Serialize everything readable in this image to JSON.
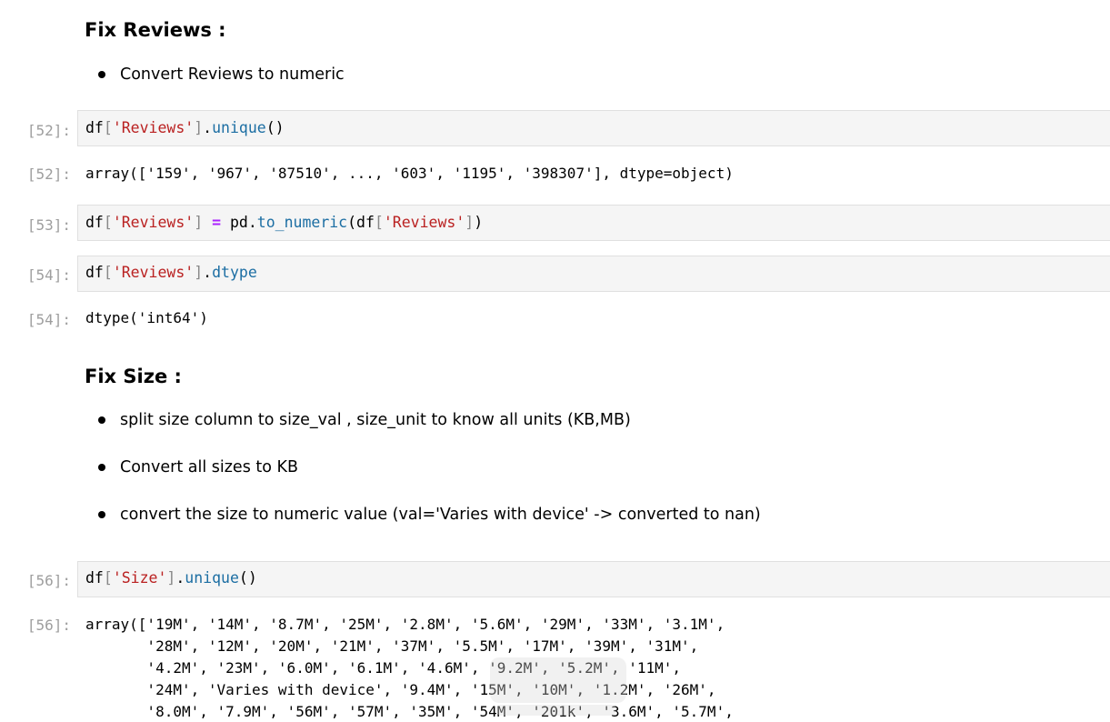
{
  "sections": {
    "fix_reviews": {
      "heading": "Fix Reviews :",
      "bullets": [
        "Convert Reviews to numeric"
      ]
    },
    "fix_size": {
      "heading": "Fix Size :",
      "bullets": [
        "split size column to size_val , size_unit to know all units (KB,MB)",
        "Convert all sizes to KB",
        "convert the size to numeric value (val='Varies with device' -> converted to nan)"
      ]
    }
  },
  "cells": {
    "c52": {
      "in_prompt": "[52]:",
      "out_prompt": "[52]:",
      "code": {
        "obj": "df",
        "lb": "[",
        "key": "'Reviews'",
        "rb": "]",
        "dot": ".",
        "method": "unique",
        "call": "()"
      },
      "output": "array(['159', '967', '87510', ..., '603', '1195', '398307'], dtype=object)"
    },
    "c53": {
      "in_prompt": "[53]:",
      "code": {
        "obj": "df",
        "lb": "[",
        "key": "'Reviews'",
        "rb": "]",
        "eq": " = ",
        "mod": "pd.",
        "func": "to_numeric",
        "open": "(df",
        "lb2": "[",
        "key2": "'Reviews'",
        "rb2": "]",
        "close": ")"
      }
    },
    "c54": {
      "in_prompt": "[54]:",
      "out_prompt": "[54]:",
      "code": {
        "obj": "df",
        "lb": "[",
        "key": "'Reviews'",
        "rb": "]",
        "dot": ".",
        "attr": "dtype"
      },
      "output": "dtype('int64')"
    },
    "c56": {
      "in_prompt": "[56]:",
      "out_prompt": "[56]:",
      "code": {
        "obj": "df",
        "lb": "[",
        "key": "'Size'",
        "rb": "]",
        "dot": ".",
        "method": "unique",
        "call": "()"
      },
      "output_lines": [
        "array(['19M', '14M', '8.7M', '25M', '2.8M', '5.6M', '29M', '33M', '3.1M',",
        "       '28M', '12M', '20M', '21M', '37M', '5.5M', '17M', '39M', '31M',",
        "       '4.2M', '23M', '6.0M', '6.1M', '4.6M', '9.2M', '5.2M', '11M',",
        "       '24M', 'Varies with device', '9.4M', '15M', '10M', '1.2M', '26M',",
        "       '8.0M', '7.9M', '56M', '57M', '35M', '54M', '201k', '3.6M', '5.7M',"
      ]
    }
  },
  "colors": {
    "string": "#ba2121",
    "attribute": "#1c6ea3",
    "operator": "#aa22ff",
    "prompt": "#9e9e9e",
    "input_bg": "#f5f5f5"
  }
}
